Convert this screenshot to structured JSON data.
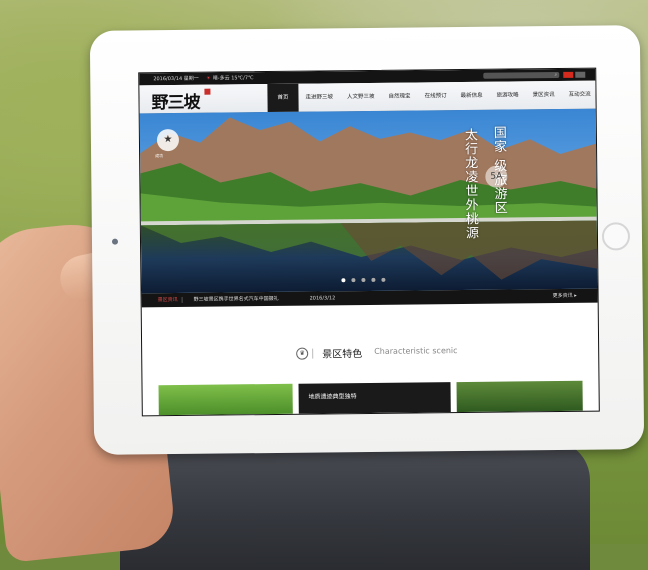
{
  "topbar": {
    "date": "2016/03/14 星期一",
    "weather": "晴-多云 15℃/7℃",
    "weather_icon": "sun-cloud-icon",
    "search_icon": "search-icon"
  },
  "nav": {
    "logo": "野三坡",
    "items": [
      {
        "label": "首页",
        "active": true
      },
      {
        "label": "走进野三坡"
      },
      {
        "label": "人文野三坡"
      },
      {
        "label": "自然瑰宝"
      },
      {
        "label": "在线预订"
      },
      {
        "label": "最新信息"
      },
      {
        "label": "旅游攻略"
      },
      {
        "label": "景区资讯"
      },
      {
        "label": "互动交流"
      }
    ]
  },
  "banner": {
    "badge_label": "成功",
    "vertical_text_1": "太行龙凌世外桃源",
    "vertical_text_2": "国家 级旅游区",
    "fivea": "5A",
    "dots": 5,
    "active_dot": 0
  },
  "news": {
    "tag": "景区资讯",
    "headline": "野三坡景区携手世界名式汽车中国摄礼",
    "date": "2016/3/12",
    "more": "更多资讯 ▸"
  },
  "section": {
    "title_cn": "景区特色",
    "title_en": "Characteristic scenic"
  },
  "cards": [
    {
      "title": ""
    },
    {
      "title": "地质遗迹典型独特"
    },
    {
      "title": ""
    }
  ],
  "colors": {
    "topbar": "#141414",
    "accent": "#c9302c",
    "nav_active": "#1a1a1a"
  }
}
